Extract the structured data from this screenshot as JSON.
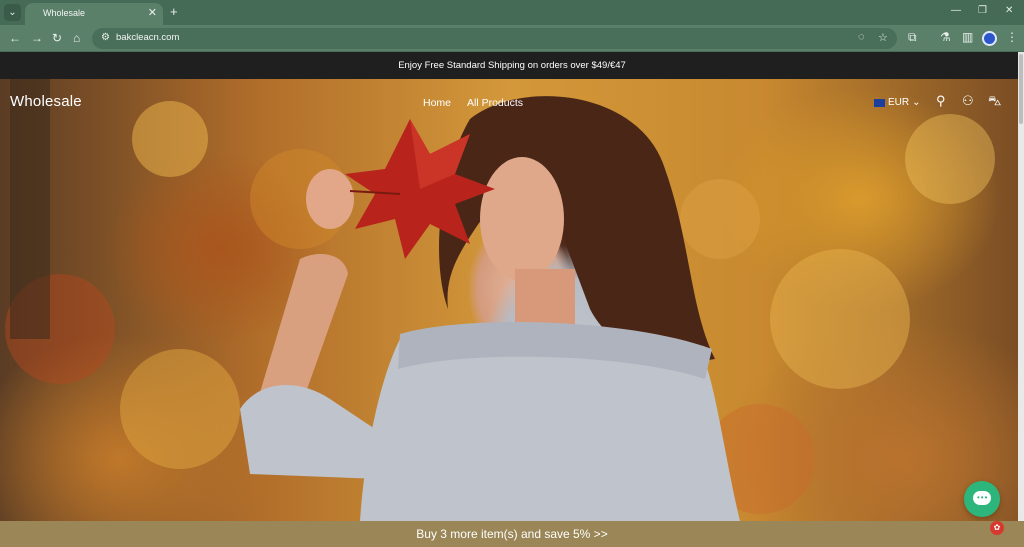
{
  "browser": {
    "tab": {
      "title": "Wholesale"
    },
    "url": "bakcleacn.com"
  },
  "announcement": "Enjoy Free Standard Shipping on orders over $49/€47",
  "header": {
    "logo": "Wholesale",
    "nav": [
      {
        "label": "Home"
      },
      {
        "label": "All Products"
      }
    ],
    "currency": "EUR"
  },
  "promo_bar": {
    "text": "Buy 3 more item(s) and save 5%  >>"
  },
  "icons": {
    "tab_menu": "chevron-down-icon",
    "tab_close": "close-icon",
    "new_tab": "plus-icon",
    "search": "search-icon",
    "account": "user-icon",
    "cart": "cart-icon",
    "chat": "chat-icon"
  },
  "colors": {
    "announcement_bg": "#1f1f1f",
    "promo_bg": "#9a8656",
    "chat_bg": "#2db67c",
    "browser_chrome": "#5a8069"
  }
}
